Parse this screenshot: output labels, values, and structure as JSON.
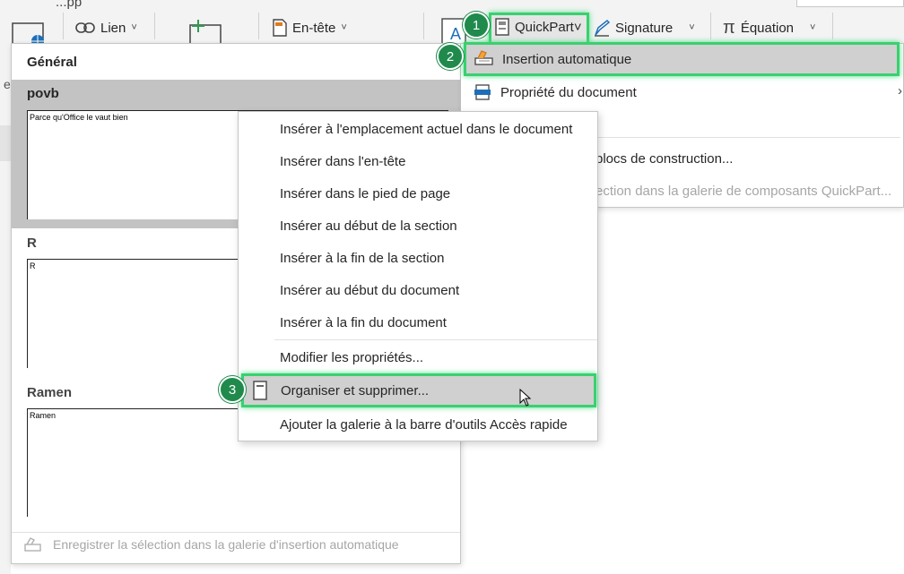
{
  "ribbon": {
    "top_fragment": "...pp",
    "lien_label": "Lien",
    "entete_label": "En-tête",
    "quickpart_label": "QuickPart",
    "signature_label": "Signature",
    "equation_label": "Équation"
  },
  "left_strip": {
    "letter": "e"
  },
  "gallery": {
    "header": "Général",
    "items": [
      {
        "name": "povb",
        "preview": "Parce qu'Office le vaut bien"
      },
      {
        "name": "R",
        "preview": "R"
      },
      {
        "name": "Ramen",
        "preview": "Ramen"
      }
    ],
    "footer": "Enregistrer la sélection dans la galerie d'insertion automatique"
  },
  "quickpart_menu": {
    "items": [
      {
        "label": "Insertion automatique"
      },
      {
        "label": "Propriété du document"
      },
      {
        "label": "blocs de construction..."
      },
      {
        "label": "ection dans la galerie de composants QuickPart..."
      }
    ]
  },
  "context_menu": {
    "items": [
      {
        "label": "Insérer à l'emplacement actuel dans le document"
      },
      {
        "label": "Insérer dans l'en-tête"
      },
      {
        "label": "Insérer dans le pied de page"
      },
      {
        "label": "Insérer au début de la section"
      },
      {
        "label": "Insérer à la fin de la section"
      },
      {
        "label": "Insérer au début du document"
      },
      {
        "label": "Insérer à la fin du document"
      },
      {
        "label": "Modifier les propriétés..."
      },
      {
        "label": "Organiser et supprimer..."
      },
      {
        "label": "Ajouter la galerie à la barre d'outils Accès rapide"
      }
    ]
  },
  "badges": [
    "1",
    "2",
    "3"
  ],
  "colors": {
    "highlight": "#3ad06f",
    "badge": "#1f8a4c",
    "selected_bg": "#c3c3c3",
    "hover_bg": "#d0d0d0",
    "disabled_text": "#a6a6a6"
  }
}
